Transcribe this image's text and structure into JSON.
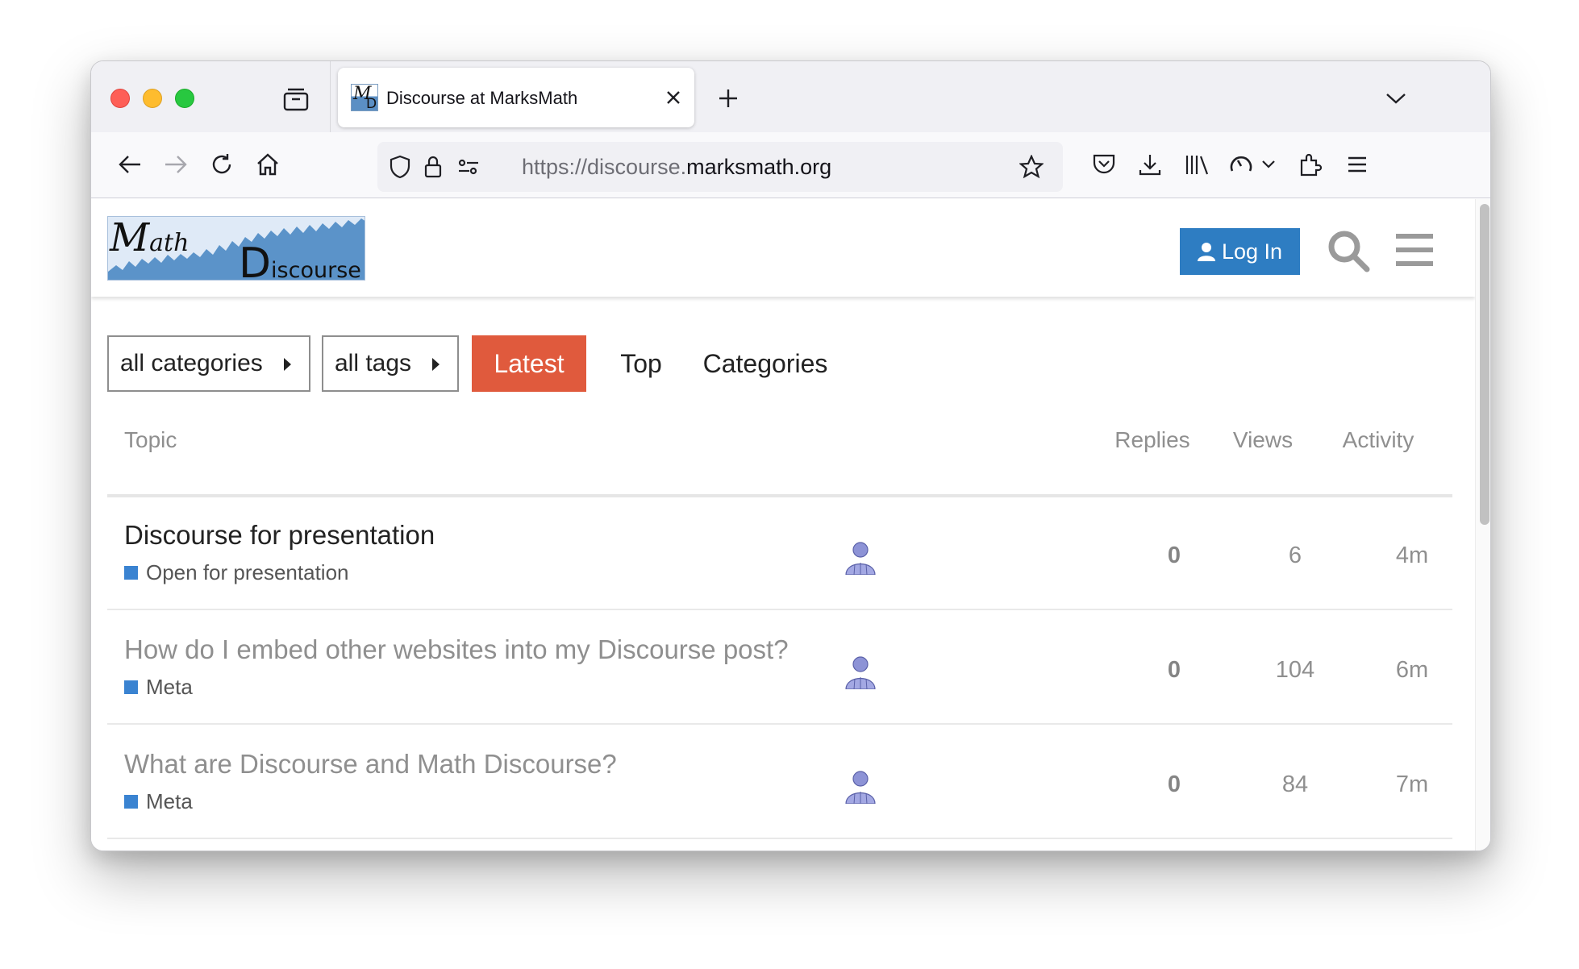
{
  "browser": {
    "tab": {
      "title": "Discourse at MarksMath",
      "favicon_text_m": "M",
      "favicon_text_d": "D"
    },
    "url": {
      "scheme_prefix": "https://discourse.",
      "host": "marksmath.org"
    },
    "icons": {
      "tab_manager": "tab-manager-icon",
      "close": "close-icon",
      "new_tab": "plus-icon",
      "tab_list": "chevron-down-icon",
      "back": "back-arrow-icon",
      "forward": "forward-arrow-icon",
      "reload": "reload-icon",
      "home": "home-icon",
      "tracking_protection": "shield-icon",
      "lock": "lock-icon",
      "permissions": "permissions-icon",
      "bookmark": "star-icon",
      "pocket": "pocket-icon",
      "downloads": "download-icon",
      "library": "library-icon",
      "profiler": "profiler-icon",
      "extensions": "puzzle-icon",
      "app_menu": "hamburger-icon"
    }
  },
  "site": {
    "logo": {
      "math_big": "M",
      "math_rest": "ath",
      "disc_big": "D",
      "disc_rest": "iscourse"
    },
    "login_label": "Log In",
    "accent": "#e05a3d",
    "brand_blue": "#2e7dc2"
  },
  "filters": {
    "categories_dropdown": "all categories",
    "tags_dropdown": "all tags",
    "tabs": [
      {
        "label": "Latest",
        "active": true
      },
      {
        "label": "Top",
        "active": false
      },
      {
        "label": "Categories",
        "active": false
      }
    ]
  },
  "table": {
    "headers": {
      "topic": "Topic",
      "replies": "Replies",
      "views": "Views",
      "activity": "Activity"
    },
    "rows": [
      {
        "title": "Discourse for presentation",
        "category": "Open for presentation",
        "replies": "0",
        "views": "6",
        "activity": "4m",
        "unread": true
      },
      {
        "title": "How do I embed other websites into my Discourse post?",
        "category": "Meta",
        "replies": "0",
        "views": "104",
        "activity": "6m",
        "unread": false
      },
      {
        "title": "What are Discourse and Math Discourse?",
        "category": "Meta",
        "replies": "0",
        "views": "84",
        "activity": "7m",
        "unread": false
      }
    ]
  }
}
